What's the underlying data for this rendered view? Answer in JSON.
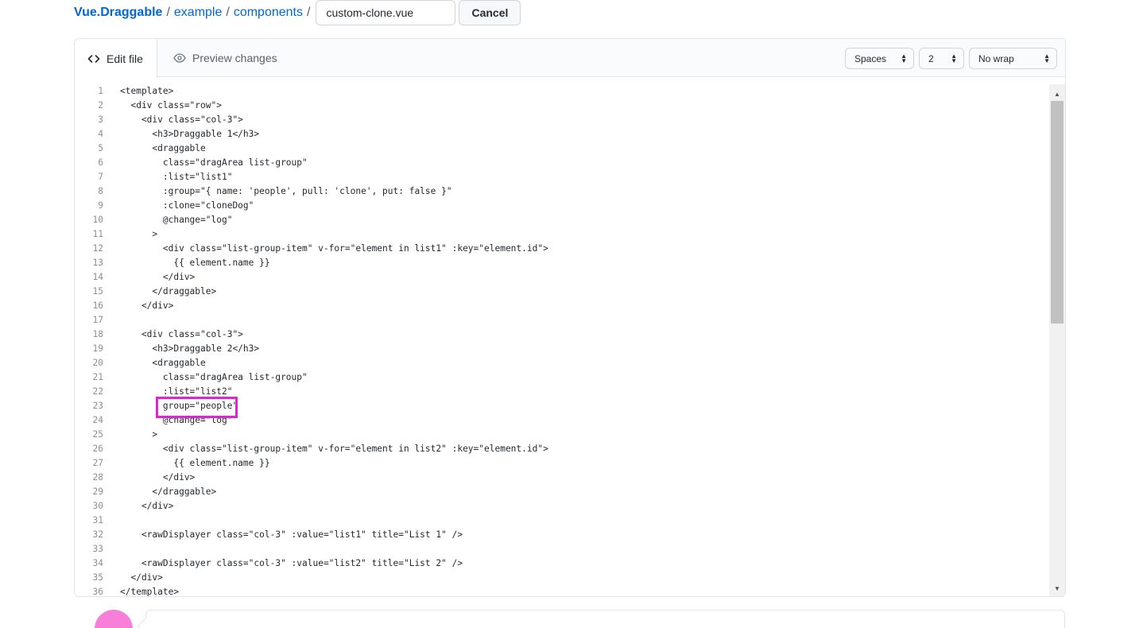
{
  "breadcrumb": {
    "repo": "Vue.Draggable",
    "path": [
      "example",
      "components"
    ],
    "separator": "/",
    "filename": "custom-clone.vue"
  },
  "buttons": {
    "cancel": "Cancel"
  },
  "tabs": {
    "edit": "Edit file",
    "preview": "Preview changes"
  },
  "editor_options": {
    "indent_mode": "Spaces",
    "indent_size": "2",
    "wrap_mode": "No wrap"
  },
  "code_lines": [
    "<template>",
    "  <div class=\"row\">",
    "    <div class=\"col-3\">",
    "      <h3>Draggable 1</h3>",
    "      <draggable",
    "        class=\"dragArea list-group\"",
    "        :list=\"list1\"",
    "        :group=\"{ name: 'people', pull: 'clone', put: false }\"",
    "        :clone=\"cloneDog\"",
    "        @change=\"log\"",
    "      >",
    "        <div class=\"list-group-item\" v-for=\"element in list1\" :key=\"element.id\">",
    "          {{ element.name }}",
    "        </div>",
    "      </draggable>",
    "    </div>",
    "",
    "    <div class=\"col-3\">",
    "      <h3>Draggable 2</h3>",
    "      <draggable",
    "        class=\"dragArea list-group\"",
    "        :list=\"list2\"",
    "        group=\"people\"",
    "        @change=\"log\"",
    "      >",
    "        <div class=\"list-group-item\" v-for=\"element in list2\" :key=\"element.id\">",
    "          {{ element.name }}",
    "        </div>",
    "      </draggable>",
    "    </div>",
    "",
    "    <rawDisplayer class=\"col-3\" :value=\"list1\" title=\"List 1\" />",
    "",
    "    <rawDisplayer class=\"col-3\" :value=\"list2\" title=\"List 2\" />",
    "  </div>",
    "</template>"
  ],
  "colors": {
    "link": "#0366d6",
    "highlight": "#e023d6",
    "avatar": "#f77fd9"
  }
}
